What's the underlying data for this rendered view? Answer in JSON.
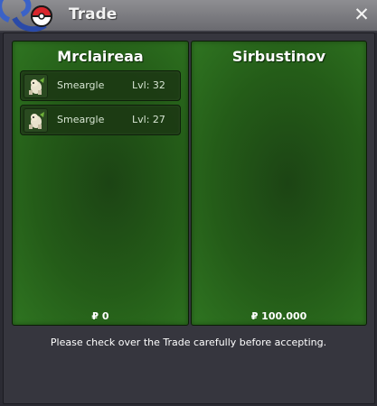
{
  "window": {
    "title": "Trade",
    "close_icon": "close-icon"
  },
  "left_player": {
    "name": "Mrclaireaa",
    "pokemon": [
      {
        "name": "Smeargle",
        "level": "Lvl: 32",
        "icon": "smeargle-sprite-icon"
      },
      {
        "name": "Smeargle",
        "level": "Lvl: 27",
        "icon": "smeargle-sprite-icon"
      }
    ],
    "money": "₽ 0"
  },
  "right_player": {
    "name": "Sirbustinov",
    "pokemon": [],
    "money": "₽ 100.000"
  },
  "notice": "Please check over the Trade carefully before accepting.",
  "colors": {
    "panel_green": "#2f7521",
    "frame": "#36363e",
    "titlebar": "#7c7c82"
  }
}
